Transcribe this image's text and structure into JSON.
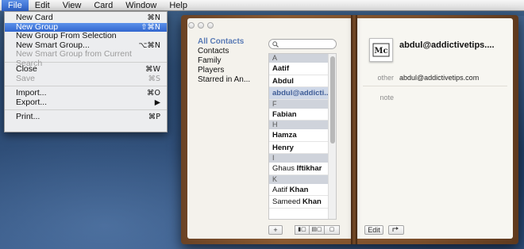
{
  "menubar": {
    "items": [
      "File",
      "Edit",
      "View",
      "Card",
      "Window",
      "Help"
    ],
    "active_index": 0
  },
  "file_menu": {
    "items": [
      {
        "label": "New Card",
        "shortcut": "⌘N",
        "disabled": false
      },
      {
        "label": "New Group",
        "shortcut": "⇧⌘N",
        "disabled": false,
        "highlighted": true
      },
      {
        "label": "New Group From Selection",
        "shortcut": "",
        "disabled": false
      },
      {
        "label": "New Smart Group...",
        "shortcut": "⌥⌘N",
        "disabled": false
      },
      {
        "label": "New Smart Group from Current Search",
        "shortcut": "",
        "disabled": true
      },
      {
        "label": "Close",
        "shortcut": "⌘W",
        "disabled": false
      },
      {
        "label": "Save",
        "shortcut": "⌘S",
        "disabled": true
      },
      {
        "label": "Import...",
        "shortcut": "⌘O",
        "disabled": false
      },
      {
        "label": "Export...",
        "shortcut": "▶",
        "disabled": false
      },
      {
        "label": "Print...",
        "shortcut": "⌘P",
        "disabled": false
      }
    ]
  },
  "groups": {
    "header": "All Contacts",
    "items": [
      "Contacts",
      "Family",
      "Players",
      "Starred in An..."
    ]
  },
  "search": {
    "placeholder": "",
    "value": ""
  },
  "contacts": [
    {
      "type": "letter",
      "text": "A"
    },
    {
      "type": "contact",
      "pre": "",
      "bold": "Aatif"
    },
    {
      "type": "contact",
      "pre": "",
      "bold": "Abdul"
    },
    {
      "type": "contact",
      "pre": "",
      "bold": "abdul@addicti...",
      "selected": true
    },
    {
      "type": "letter",
      "text": "F"
    },
    {
      "type": "contact",
      "pre": "",
      "bold": "Fabian"
    },
    {
      "type": "letter",
      "text": "H"
    },
    {
      "type": "contact",
      "pre": "",
      "bold": "Hamza"
    },
    {
      "type": "contact",
      "pre": "",
      "bold": "Henry"
    },
    {
      "type": "letter",
      "text": "I"
    },
    {
      "type": "contact",
      "pre": "Ghaus ",
      "bold": "Iftikhar"
    },
    {
      "type": "letter",
      "text": "K"
    },
    {
      "type": "contact",
      "pre": "Aatif ",
      "bold": "Khan"
    },
    {
      "type": "contact",
      "pre": "Sameed ",
      "bold": "Khan"
    }
  ],
  "list_buttons": {
    "add": "+",
    "view1": "▮▢",
    "view2": "▤▢",
    "view3": "▢"
  },
  "card": {
    "name": "abdul@addictivetips....",
    "fields": [
      {
        "label": "other",
        "value": "abdul@addictivetips.com"
      },
      {
        "label": "note",
        "value": ""
      }
    ],
    "edit_label": "Edit",
    "share_icon": "share-icon"
  },
  "colors": {
    "menu_highlight": "#3166cf",
    "group_header": "#5a7bb5",
    "book_leather": "#8a5a31"
  }
}
